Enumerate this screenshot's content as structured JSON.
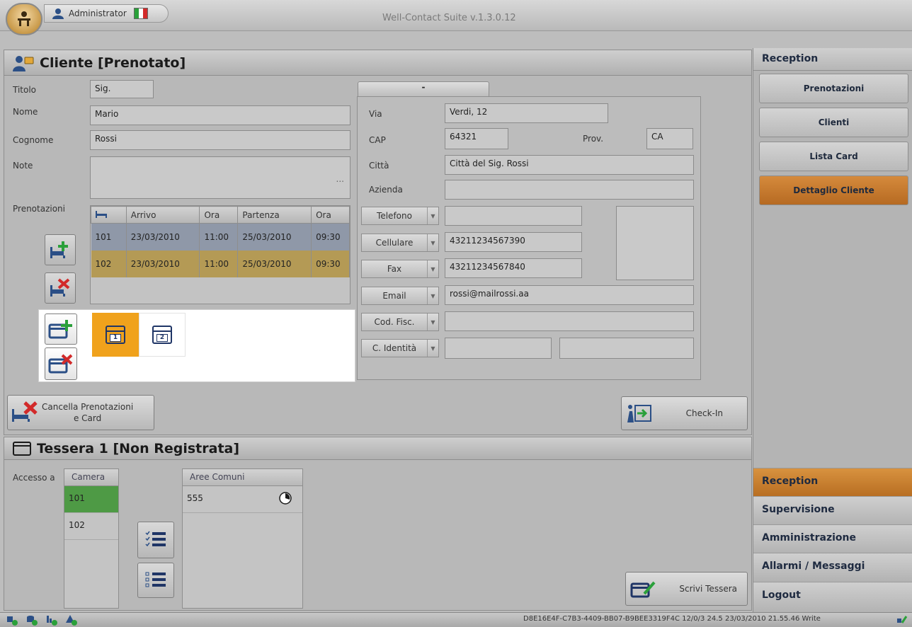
{
  "app": {
    "title": "Well-Contact Suite v.1.3.0.12",
    "user": "Administrator",
    "flag_colors": [
      "#2aa03a",
      "#ffffff",
      "#d22a2a"
    ]
  },
  "client": {
    "header": "Cliente [Prenotato]",
    "titolo_label": "Titolo",
    "titolo_value": "Sig.",
    "nome_label": "Nome",
    "nome_value": "Mario",
    "cognome_label": "Cognome",
    "cognome_value": "Rossi",
    "note_label": "Note",
    "note_value": "",
    "note_more": "...",
    "prenotazioni_label": "Prenotazioni",
    "reservations": {
      "columns": [
        "",
        "Arrivo",
        "Ora",
        "Partenza",
        "Ora"
      ],
      "rows": [
        {
          "room": "101",
          "arrivo": "23/03/2010",
          "ora1": "11:00",
          "partenza": "25/03/2010",
          "ora2": "09:30"
        },
        {
          "room": "102",
          "arrivo": "23/03/2010",
          "ora1": "11:00",
          "partenza": "25/03/2010",
          "ora2": "09:30"
        }
      ]
    },
    "cards": [
      "1",
      "2"
    ],
    "tab_label": "-",
    "via_label": "Via",
    "via_value": "Verdi, 12",
    "cap_label": "CAP",
    "cap_value": "64321",
    "prov_label": "Prov.",
    "prov_value": "CA",
    "citta_label": "Città",
    "citta_value": "Città del Sig. Rossi",
    "azienda_label": "Azienda",
    "azienda_value": "",
    "contacts": [
      {
        "label": "Telefono",
        "value": ""
      },
      {
        "label": "Cellulare",
        "value": "43211234567390"
      },
      {
        "label": "Fax",
        "value": "43211234567840"
      },
      {
        "label": "Email",
        "value": "rossi@mailrossi.aa"
      },
      {
        "label": "Cod. Fisc.",
        "value": ""
      },
      {
        "label": "C. Identità",
        "value": ""
      }
    ],
    "cancel_button_line1": "Cancella Prenotazioni",
    "cancel_button_line2": "e Card",
    "checkin_button": "Check-In"
  },
  "tessera": {
    "header": "Tessera 1 [Non Registrata]",
    "accesso_label": "Accesso a",
    "camera_header": "Camera",
    "camera_rows": [
      "101",
      "102"
    ],
    "aree_header": "Aree Comuni",
    "aree_rows": [
      "555"
    ],
    "write_button": "Scrivi Tessera"
  },
  "sidebar": {
    "section_title": "Reception",
    "buttons": [
      "Prenotazioni",
      "Clienti",
      "Lista Card",
      "Dettaglio Cliente"
    ],
    "active_button": "Dettaglio Cliente",
    "nav": [
      "Reception",
      "Supervisione",
      "Amministrazione",
      "Allarmi / Messaggi",
      "Logout"
    ],
    "active_nav": "Reception"
  },
  "status": {
    "text": "D8E16E4F-C7B3-4409-BB07-B9BEE3319F4C 12/0/3 24.5 23/03/2010 21.55.46 Write"
  }
}
